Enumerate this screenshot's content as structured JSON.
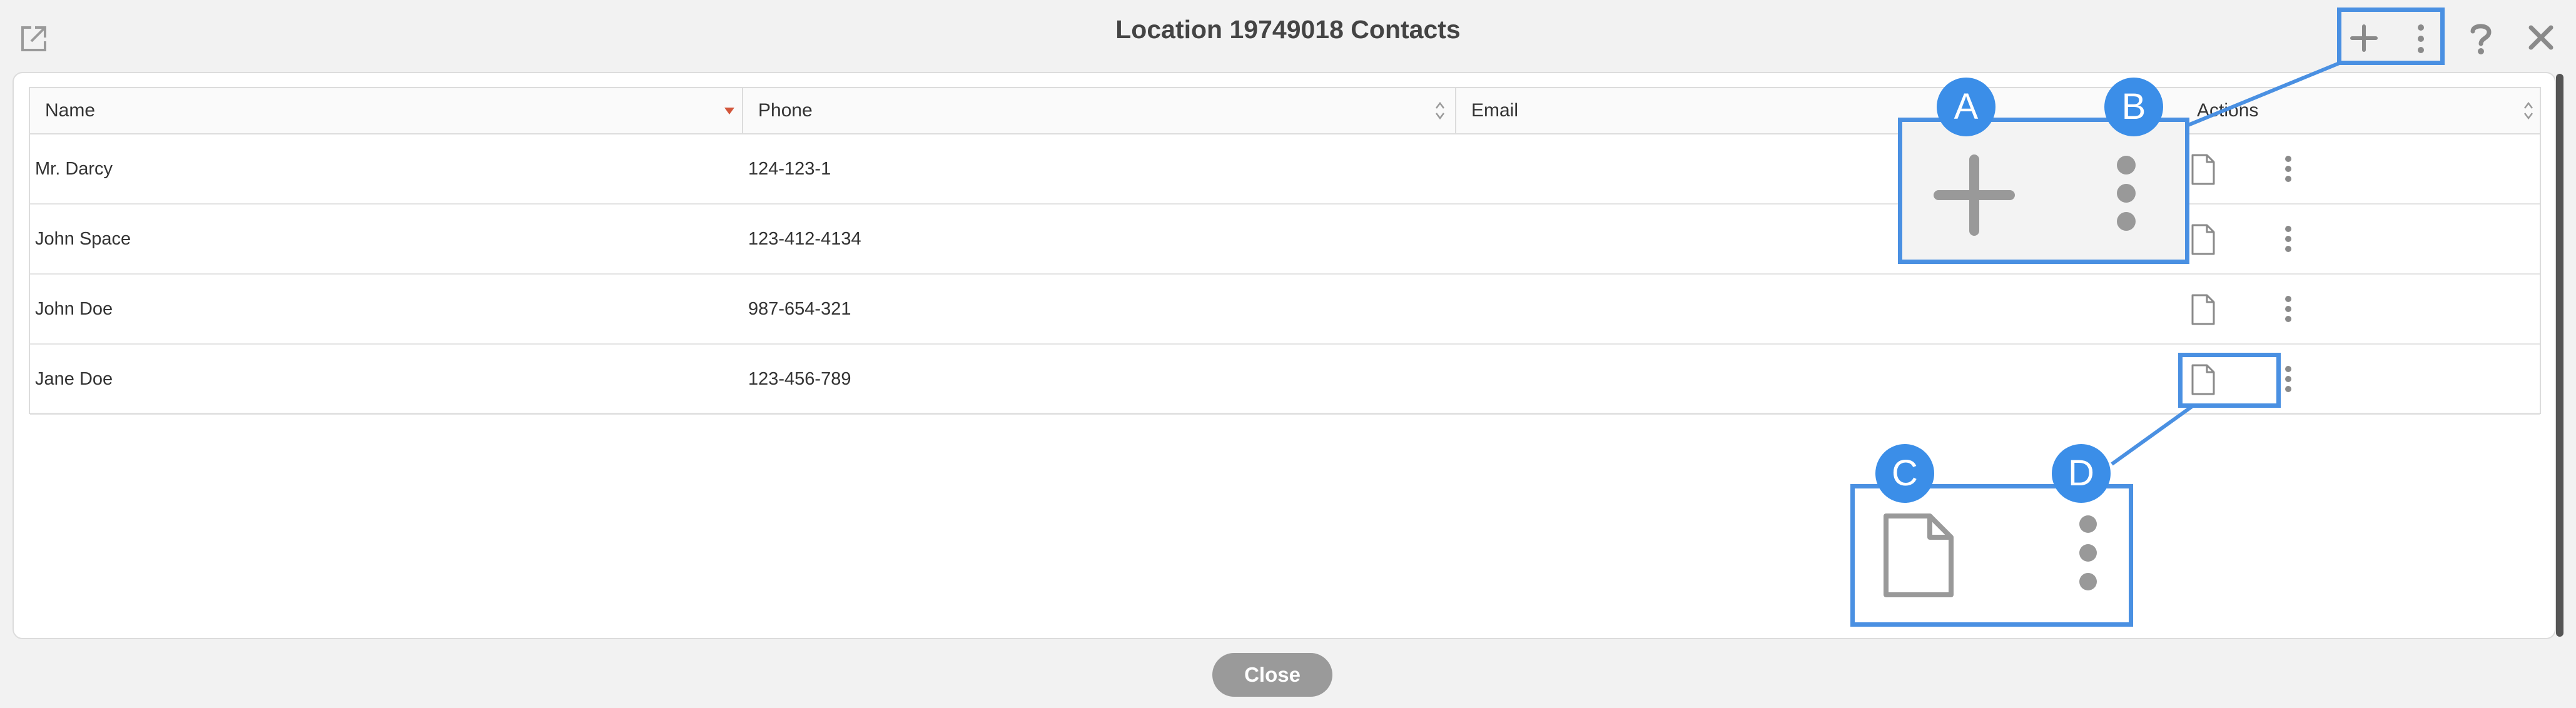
{
  "dialog": {
    "title": "Location 19749018 Contacts",
    "close_label": "Close"
  },
  "toolbar": {
    "popout_icon": "external-link-icon",
    "add_icon": "plus-icon",
    "more_icon": "kebab-menu-icon",
    "help_icon": "question-icon",
    "close_icon": "close-icon"
  },
  "table": {
    "columns": [
      "Name",
      "Phone",
      "Email",
      "Actions"
    ],
    "sorted_column": "Name",
    "rows": [
      {
        "name": "Mr. Darcy",
        "phone": "124-123-1",
        "email": ""
      },
      {
        "name": "John Space",
        "phone": "123-412-4134",
        "email": ""
      },
      {
        "name": "John Doe",
        "phone": "987-654-321",
        "email": ""
      },
      {
        "name": "Jane Doe",
        "phone": "123-456-789",
        "email": ""
      }
    ],
    "row_action_icons": [
      "document-icon",
      "kebab-menu-icon"
    ]
  },
  "annotations": {
    "badges": [
      "A",
      "B",
      "C",
      "D"
    ],
    "accent_color": "#3b8ee8"
  }
}
